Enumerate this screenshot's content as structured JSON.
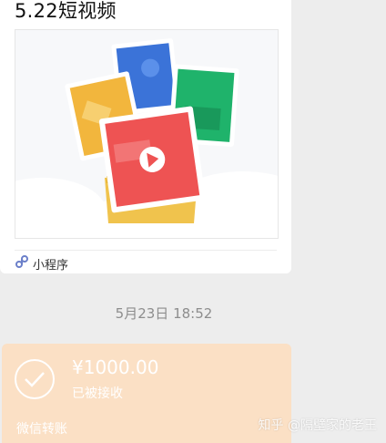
{
  "mini_program": {
    "title": "5.22短视频",
    "label": "小程序",
    "icon": "mini-program-icon"
  },
  "timestamp": "5月23日 18:52",
  "transfer": {
    "amount": "¥1000.00",
    "status": "已被接收",
    "label": "微信转账",
    "icon": "check-circle-icon"
  },
  "watermark": "知乎 @隔壁家的老王",
  "colors": {
    "bubble": "#fbe0c5",
    "background": "#ededed",
    "card_blue": "#3b73d8",
    "card_yellow": "#f2b63d",
    "card_green": "#1fb36b",
    "card_red": "#ee5353"
  }
}
